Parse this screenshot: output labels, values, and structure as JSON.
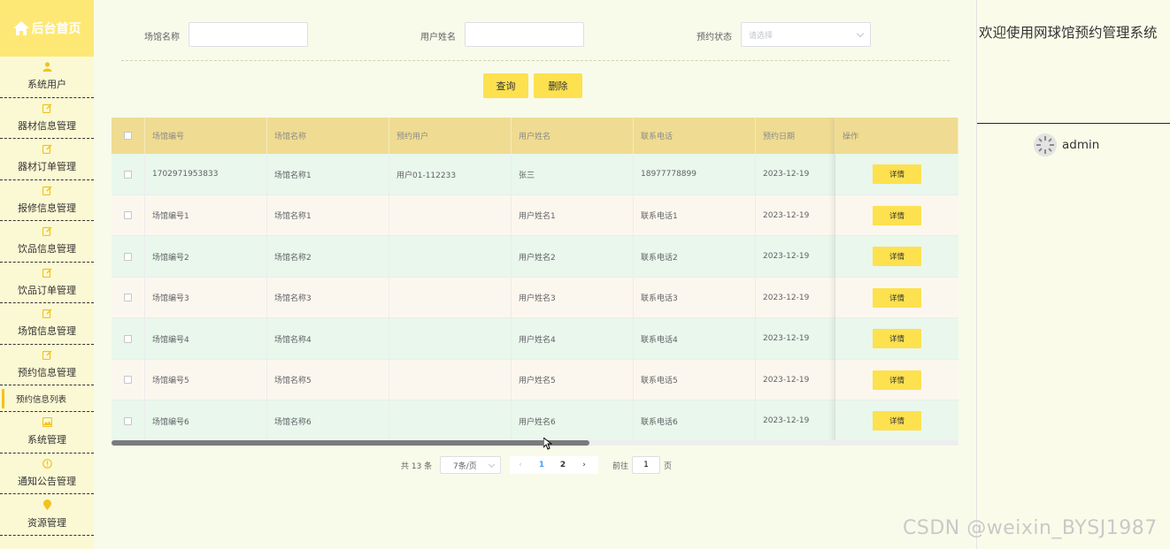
{
  "sidebar": {
    "brand": "后台首页",
    "items": [
      {
        "label": "系统用户",
        "icon": "user-icon"
      },
      {
        "label": "器材信息管理",
        "icon": "edit-icon"
      },
      {
        "label": "器材订单管理",
        "icon": "edit-icon"
      },
      {
        "label": "报修信息管理",
        "icon": "edit-icon"
      },
      {
        "label": "饮品信息管理",
        "icon": "edit-icon"
      },
      {
        "label": "饮品订单管理",
        "icon": "edit-icon"
      },
      {
        "label": "场馆信息管理",
        "icon": "edit-icon"
      },
      {
        "label": "预约信息管理",
        "icon": "edit-icon"
      }
    ],
    "active_sub": "预约信息列表",
    "items_after": [
      {
        "label": "系统管理",
        "icon": "picture-icon"
      },
      {
        "label": "通知公告管理",
        "icon": "info-icon"
      },
      {
        "label": "资源管理",
        "icon": "location-icon"
      }
    ]
  },
  "search": {
    "venue_name_label": "场馆名称",
    "user_name_label": "用户姓名",
    "status_label": "预约状态",
    "status_placeholder": "请选择",
    "query_button": "查询",
    "delete_button": "删除"
  },
  "table": {
    "columns": [
      "场馆编号",
      "场馆名称",
      "预约用户",
      "用户姓名",
      "联系电话",
      "预约日期",
      "操作"
    ],
    "rows": [
      [
        "1702971953833",
        "场馆名称1",
        "用户01-112233",
        "张三",
        "18977778899",
        "2023-12-19"
      ],
      [
        "场馆编号1",
        "场馆名称1",
        "",
        "用户姓名1",
        "联系电话1",
        "2023-12-19"
      ],
      [
        "场馆编号2",
        "场馆名称2",
        "",
        "用户姓名2",
        "联系电话2",
        "2023-12-19"
      ],
      [
        "场馆编号3",
        "场馆名称3",
        "",
        "用户姓名3",
        "联系电话3",
        "2023-12-19"
      ],
      [
        "场馆编号4",
        "场馆名称4",
        "",
        "用户姓名4",
        "联系电话4",
        "2023-12-19"
      ],
      [
        "场馆编号5",
        "场馆名称5",
        "",
        "用户姓名5",
        "联系电话5",
        "2023-12-19"
      ],
      [
        "场馆编号6",
        "场馆名称6",
        "",
        "用户姓名6",
        "联系电话6",
        "2023-12-19"
      ]
    ],
    "detail_label": "详情"
  },
  "pagination": {
    "total": "共 13 条",
    "page_size": "7条/页",
    "prev": "‹",
    "next": "›",
    "pages": [
      "1",
      "2"
    ],
    "current_page": "1",
    "goto_label": "前往",
    "goto_value": "1",
    "page_unit": "页"
  },
  "right_panel": {
    "welcome": "欢迎使用网球馆预约管理系统",
    "username": "admin"
  },
  "watermark": "CSDN @weixin_BYSJ1987",
  "colors": {
    "accent": "#fde14f",
    "brand_bg": "#fde875",
    "header_bg": "#efdc92",
    "row_even": "#e9f7ec",
    "row_odd": "#fcf7ee"
  }
}
